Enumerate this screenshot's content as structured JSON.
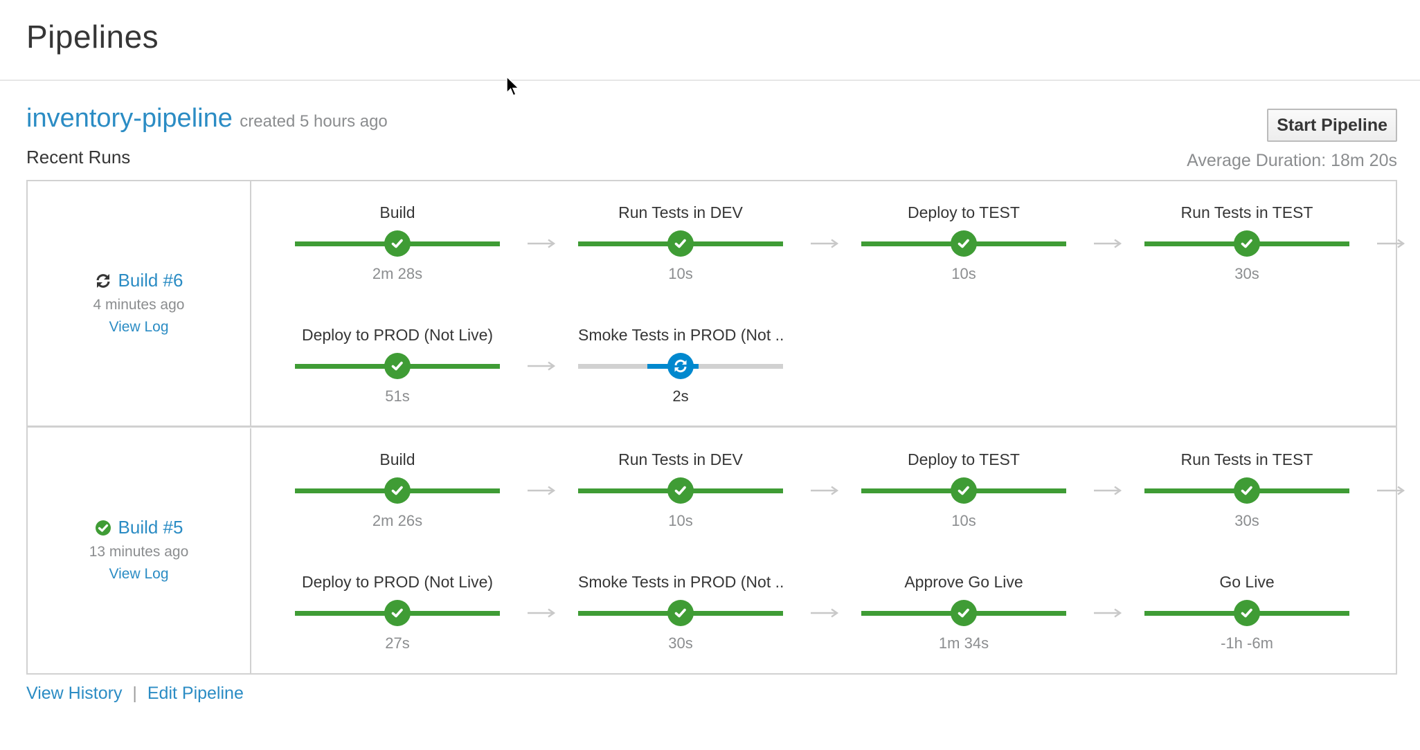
{
  "page": {
    "title": "Pipelines"
  },
  "pipeline": {
    "name": "inventory-pipeline",
    "created": "created 5 hours ago",
    "recent_runs_label": "Recent Runs",
    "start_button": "Start Pipeline",
    "average_duration": "Average Duration: 18m 20s"
  },
  "runs": [
    {
      "build": "Build #6",
      "status": "running",
      "status_icon": "refresh-icon",
      "time": "4 minutes ago",
      "view_log": "View Log",
      "stages": [
        {
          "name": "Build",
          "duration": "2m 28s",
          "status": "complete"
        },
        {
          "name": "Run Tests in DEV",
          "duration": "10s",
          "status": "complete"
        },
        {
          "name": "Deploy to TEST",
          "duration": "10s",
          "status": "complete"
        },
        {
          "name": "Run Tests in TEST",
          "duration": "30s",
          "status": "complete"
        },
        {
          "name": "Deploy to PROD (Not Live)",
          "duration": "51s",
          "status": "complete"
        },
        {
          "name": "Smoke Tests in PROD (Not ...",
          "duration": "2s",
          "status": "running"
        }
      ]
    },
    {
      "build": "Build #5",
      "status": "complete",
      "status_icon": "check-circle-icon",
      "time": "13 minutes ago",
      "view_log": "View Log",
      "stages": [
        {
          "name": "Build",
          "duration": "2m 26s",
          "status": "complete"
        },
        {
          "name": "Run Tests in DEV",
          "duration": "10s",
          "status": "complete"
        },
        {
          "name": "Deploy to TEST",
          "duration": "10s",
          "status": "complete"
        },
        {
          "name": "Run Tests in TEST",
          "duration": "30s",
          "status": "complete"
        },
        {
          "name": "Deploy to PROD (Not Live)",
          "duration": "27s",
          "status": "complete"
        },
        {
          "name": "Smoke Tests in PROD (Not ...",
          "duration": "30s",
          "status": "complete"
        },
        {
          "name": "Approve Go Live",
          "duration": "1m 34s",
          "status": "complete"
        },
        {
          "name": "Go Live",
          "duration": "-1h -6m",
          "status": "complete"
        }
      ]
    }
  ],
  "footer": {
    "view_history": "View History",
    "separator": "|",
    "edit_pipeline": "Edit Pipeline"
  },
  "colors": {
    "success": "#3f9c35",
    "running": "#0088ce",
    "link": "#2b8cc4",
    "pending": "#d1d1d1"
  }
}
